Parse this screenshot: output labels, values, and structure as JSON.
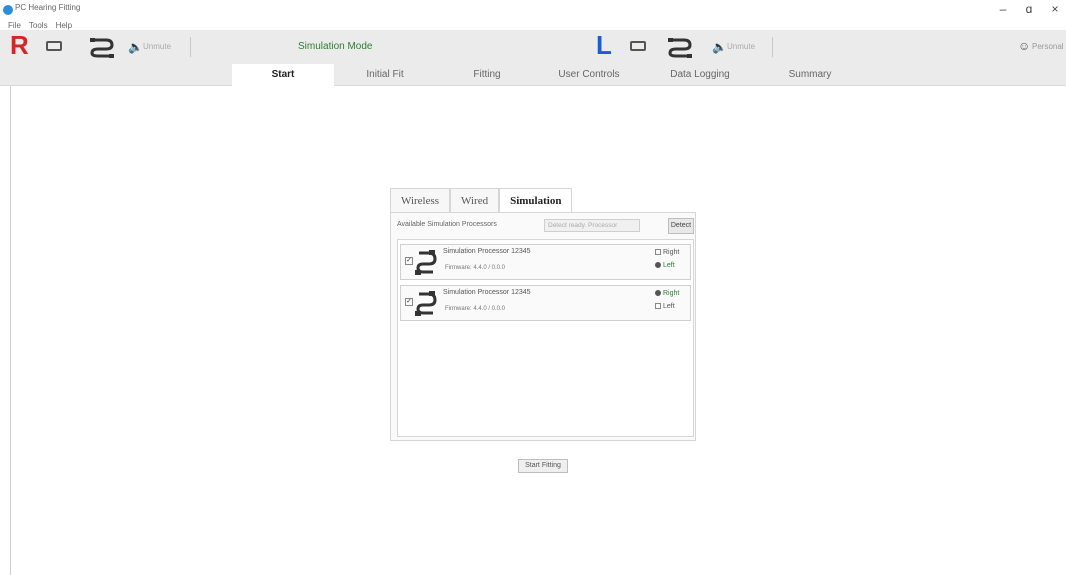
{
  "window": {
    "title": "PC Hearing Fitting",
    "minimize": "–",
    "maximize": "ɑ",
    "close": "×"
  },
  "menu": [
    "File",
    "Tools",
    "Help"
  ],
  "toolbar": {
    "right_side": {
      "letter": "R",
      "color": "#d42626",
      "device_icon": "hearing-aid-device-icon",
      "connection_icon": "connection-plug-icon",
      "volume_icon": "speaker-icon",
      "volume_label": "Unmute"
    },
    "mode_label": "Simulation Mode",
    "left_side": {
      "letter": "L",
      "color": "#1a5bd6",
      "device_icon": "hearing-aid-device-icon",
      "connection_icon": "connection-plug-icon",
      "volume_icon": "speaker-icon",
      "volume_label": "Unmute"
    },
    "profile_icon": "person-icon",
    "profile_label": "Personal"
  },
  "nav_tabs": [
    {
      "label": "Start",
      "active": true
    },
    {
      "label": "Initial Fit",
      "active": false
    },
    {
      "label": "Fitting",
      "active": false
    },
    {
      "label": "User Controls",
      "active": false
    },
    {
      "label": "Data Logging",
      "active": false
    },
    {
      "label": "Summary",
      "active": false
    }
  ],
  "panel": {
    "tabs": [
      {
        "label": "Wireless",
        "active": false
      },
      {
        "label": "Wired",
        "active": false
      },
      {
        "label": "Simulation",
        "active": true
      }
    ],
    "available_label": "Available Simulation Processors",
    "status_text": "Detect ready. Processor",
    "detect_label": "Detect",
    "processors": [
      {
        "checked": true,
        "name": "Simulation Processor 12345",
        "firmware": "Firmware: 4.4.0 / 0.0.0",
        "options": [
          {
            "label": "Right",
            "selected": false
          },
          {
            "label": "Left",
            "selected": true
          }
        ]
      },
      {
        "checked": true,
        "name": "Simulation Processor 12345",
        "firmware": "Firmware: 4.4.0 / 0.0.0",
        "options": [
          {
            "label": "Right",
            "selected": true
          },
          {
            "label": "Left",
            "selected": false
          }
        ]
      }
    ]
  },
  "start_fitting_label": "Start Fitting"
}
